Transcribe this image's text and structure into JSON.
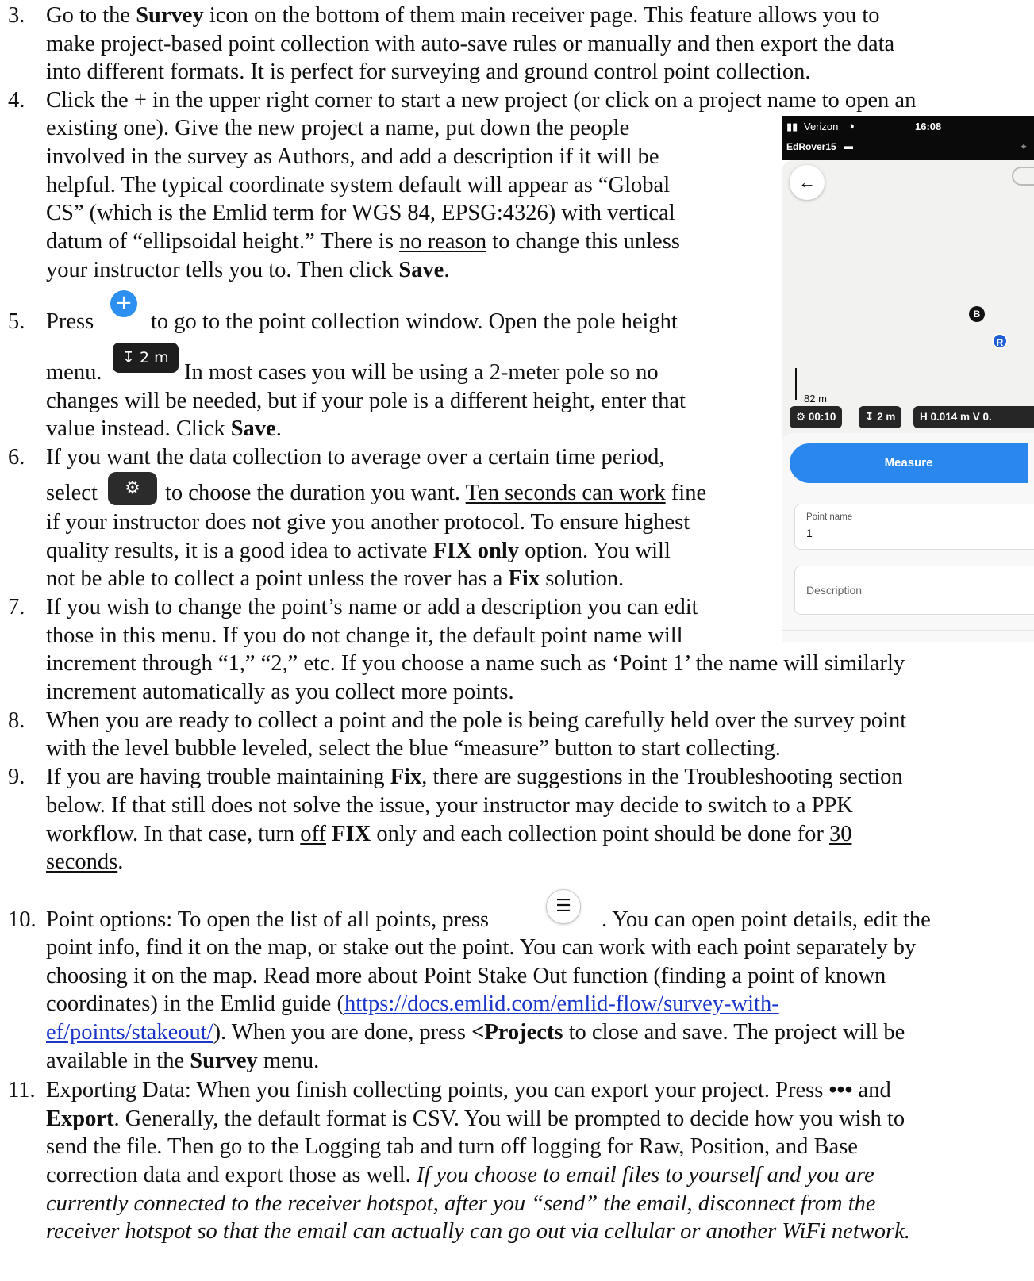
{
  "item3": {
    "number": "3.",
    "l1a": "Go to the ",
    "l1b": "Survey",
    "l1c": " icon on the bottom of them main receiver page. This feature allows you to",
    "l2": "make project-based point collection with auto-save rules or manually and then export the data",
    "l3": "into different formats. It is perfect for surveying and ground control point collection."
  },
  "item4": {
    "number": "4.",
    "l1": "Click the + in the upper right corner to start a new project (or click on a project name to open an",
    "l2": "existing one). Give the new project a name, put down the people",
    "l3": "involved in the survey as Authors, and add a description if it will be",
    "l4": "helpful. The typical coordinate system default will appear as “Global",
    "l5": "CS” (which is the Emlid term for WGS 84, EPSG:4326) with vertical",
    "l6": "datum of “ellipsoidal height.” There is ",
    "l6u": "no reason",
    "l6b": " to change this unless",
    "l7a": "your instructor tells you to. Then click ",
    "l7b": "Save",
    "l7c": "."
  },
  "item5": {
    "number": "5.",
    "l1a": "Press",
    "plus_icon": "+",
    "l1b": "to go to the point collection window. Open the pole height",
    "pole_chip": "2 m",
    "l2a": "menu.",
    "l2b": "In most cases you will be using a 2-meter pole so no",
    "l3": "changes will be needed, but if your pole is a different height, enter that",
    "l4a": "value instead. Click ",
    "l4b": "Save",
    "l4c": "."
  },
  "item6": {
    "number": "6.",
    "l1": "If you want the data collection to average over a certain time period,",
    "l2a": "select",
    "gear_icon": "⚙",
    "l2b": "to choose the duration you want. ",
    "l2u": "Ten seconds can work",
    "l2c": " fine",
    "l3": "if your instructor does not give you another protocol. To ensure highest",
    "l4a": "quality results, it is a good idea to activate ",
    "l4b": "FIX only",
    "l4c": " option. You will",
    "l5a": "not be able to collect a point unless the rover has a ",
    "l5b": "Fix",
    "l5c": " solution."
  },
  "item7": {
    "number": "7.",
    "l1": "If you wish to change the point’s name or add a description you can edit",
    "l2": "those in this menu. If you do not change it, the default point name will",
    "l3": "increment through “1,” “2,” etc. If you choose a name such as ‘Point 1’ the name will similarly",
    "l4": "increment automatically as you collect more points."
  },
  "item8": {
    "number": "8.",
    "l1": "When you are ready to collect a point and the pole is being carefully held over the survey point",
    "l2": "with the level bubble leveled, select the blue “measure” button to start collecting."
  },
  "item9": {
    "number": "9.",
    "l1a": "If you are having trouble maintaining ",
    "l1b": "Fix",
    "l1c": ", there are suggestions in the Troubleshooting section",
    "l2": "below. If that still does not solve the issue, your instructor may decide to switch to a PPK",
    "l3a": "workflow. In that case, turn ",
    "l3u": "off",
    "l3b": " FIX",
    "l3c": " only and each collection point should be done for ",
    "l3u2": "30",
    "l4u": "seconds",
    "l4c": "."
  },
  "item10": {
    "number": "10.",
    "l1a": "Point options: To open the list of all points, press",
    "list_icon": "☰",
    "l1b": ". You can open point details, edit the",
    "l2": "point info, find it on the map, or stake out the point. You can work with each point separately by",
    "l3": "choosing it on the map. Read more about Point Stake Out function (finding a point of known",
    "l4a": "coordinates) in the Emlid guide (",
    "link1": "https://docs.emlid.com/emlid-flow/survey-with-",
    "link2": "ef/points/stakeout/",
    "l5a": "). When you are done, press ",
    "l5b": "<Projects",
    "l5c": " to close and save. The project will be",
    "l6a": "available in the ",
    "l6b": "Survey",
    "l6c": " menu."
  },
  "item11": {
    "number": "11.",
    "l1a": "Exporting Data: When you finish collecting points, you can export your project. Press ",
    "l1b": "•••",
    "l1c": " and",
    "l2a": "Export",
    "l2b": ". Generally, the default format is CSV. You will be prompted to decide how you wish to",
    "l3": "send the file. Then go to the Logging tab and turn off logging for Raw, Position, and Base",
    "l4": "correction data and export those as well. ",
    "l4i": "If you choose to email files to yourself and you are",
    "l5i": "currently connected to the receiver hotspot, after you “send” the email, disconnect from the",
    "l6i": "receiver hotspot so that the email can actually can go out via cellular or another WiFi network."
  },
  "phone": {
    "carrier": "Verizon",
    "time": "16:08",
    "device": "EdRover15",
    "scale": "82 m",
    "timer_chip": "00:10",
    "pole_chip": "2 m",
    "accuracy_chip": "H 0.014 m  V 0.",
    "measure": "Measure",
    "point_name_label": "Point name",
    "point_name_value": "1",
    "description_placeholder": "Description",
    "marker_b": "B",
    "marker_r": "R",
    "back_icon": "←",
    "colors": {
      "accent": "#2a87ee",
      "chip": "#262626",
      "map": "#f2f2f1"
    }
  }
}
